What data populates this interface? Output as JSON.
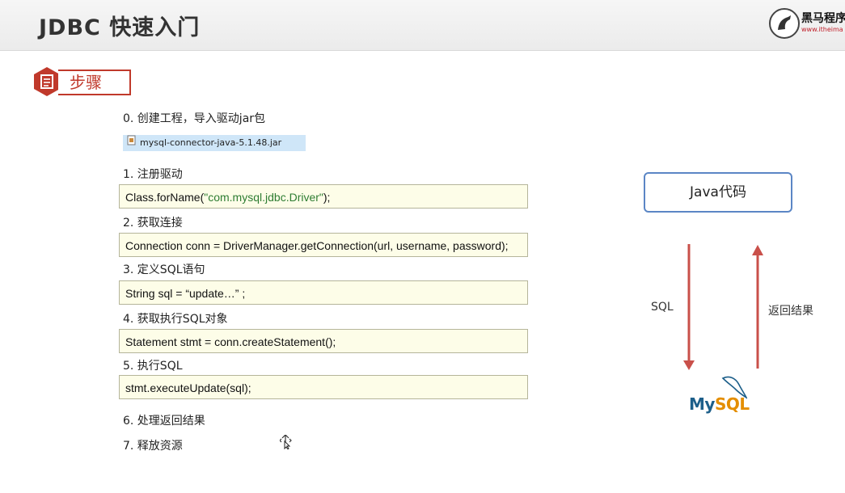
{
  "header": {
    "title": "JDBC 快速入门",
    "logo_name": "黑马程序",
    "logo_url": "www.itheima"
  },
  "section": {
    "label": "步骤"
  },
  "steps": [
    {
      "label": "0.   创建工程，导入驱动jar包"
    },
    {
      "label": "1.   注册驱动"
    },
    {
      "label": "2.   获取连接"
    },
    {
      "label": "3.   定义SQL语句"
    },
    {
      "label": "4.   获取执行SQL对象"
    },
    {
      "label": "5.   执行SQL"
    },
    {
      "label": "6.   处理返回结果"
    },
    {
      "label": "7.   释放资源"
    }
  ],
  "jar_file": "mysql-connector-java-5.1.48.jar",
  "code": {
    "register_prefix": "Class.forName(",
    "register_string": "\"com.mysql.jdbc.Driver\"",
    "register_suffix": ");",
    "connection": "Connection conn = DriverManager.getConnection(url, username, password);",
    "sql": "String sql =  “update…” ;",
    "statement": "Statement stmt = conn.createStatement();",
    "execute": "stmt.executeUpdate(sql);"
  },
  "diagram": {
    "java_box": "Java代码",
    "down_label": "SQL",
    "up_label": "返回结果",
    "db_logo_my": "My",
    "db_logo_sql": "SQL",
    "arrow_color": "#c9504a"
  },
  "icons": {
    "jar_icon": "jar-file-icon",
    "steps_icon": "document-icon",
    "logo_icon": "horse-logo-icon",
    "db_icon": "dolphin-icon"
  },
  "colors": {
    "accent_red": "#c0392b",
    "code_bg": "#fdfde8",
    "java_box_border": "#5b86c5",
    "string_green": "#2e7d32"
  }
}
